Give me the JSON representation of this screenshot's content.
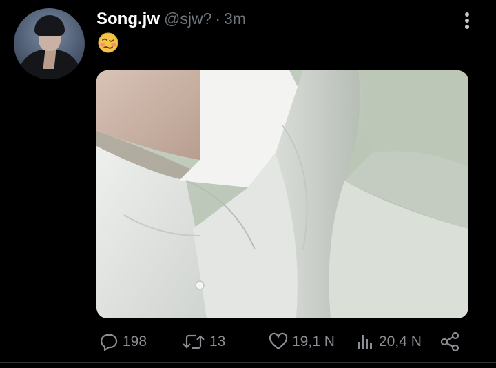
{
  "tweet": {
    "author_name": "Song.jw",
    "author_handle": "@sjw?",
    "separator": "·",
    "time": "3m",
    "emoji": "woozy-face"
  },
  "actions": {
    "replies": "198",
    "retweets": "13",
    "likes": "19,1 N",
    "views": "20,4 N"
  },
  "icons": [
    "more-vertical-icon",
    "reply-icon",
    "retweet-icon",
    "like-icon",
    "views-icon",
    "share-icon"
  ],
  "colors": {
    "background": "#000000",
    "name": "#ffffff",
    "secondary_text": "#71767b",
    "action_text": "#8b8f94"
  }
}
